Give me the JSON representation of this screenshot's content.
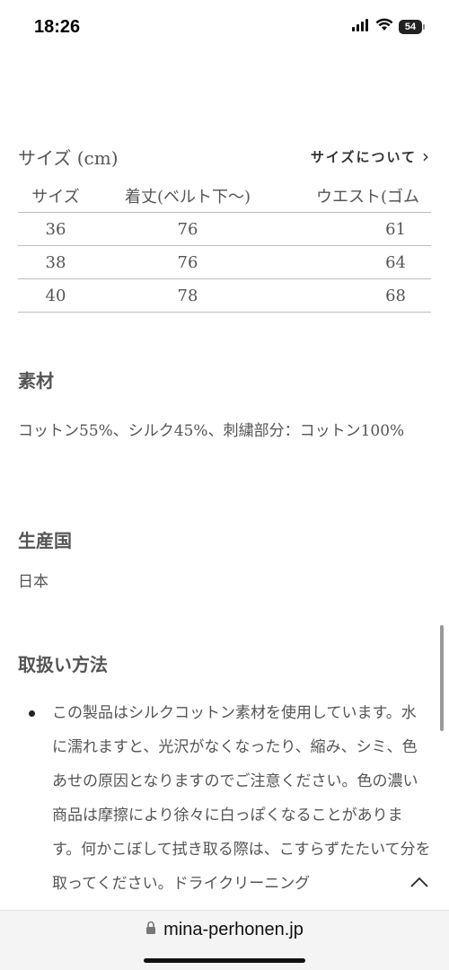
{
  "status_bar": {
    "time": "18:26",
    "battery": "54",
    "icons": [
      "signal-icon",
      "wifi-icon",
      "battery-icon"
    ]
  },
  "size_section": {
    "title": "サイズ (cm)",
    "link_label": "サイズについて",
    "columns": [
      "サイズ",
      "着丈(ベルト下〜)",
      "ウエスト(ゴム"
    ],
    "rows": [
      [
        "36",
        "76",
        "61"
      ],
      [
        "38",
        "76",
        "64"
      ],
      [
        "40",
        "78",
        "68"
      ]
    ]
  },
  "material": {
    "title": "素材",
    "text": "コットン55%、シルク45%、刺繍部分：コットン100%"
  },
  "origin": {
    "title": "生産国",
    "text": "日本"
  },
  "care": {
    "title": "取扱い方法",
    "items": [
      "この製品はシルクコットン素材を使用しています。水に濡れますと、光沢がなくなったり、縮み、シミ、色あせの原因となりますのでご注意ください。色の濃い商品は摩擦により徐々に白っぽくなることがあります。何かこぼして拭き取る際は、こすらずたたいて分を取ってください。ドライクリーニング"
    ]
  },
  "browser": {
    "url": "mina-perhonen.jp"
  },
  "colors": {
    "text": "#555555",
    "divider": "#bdbdbd",
    "url_bar_bg": "#f4f4f4"
  }
}
